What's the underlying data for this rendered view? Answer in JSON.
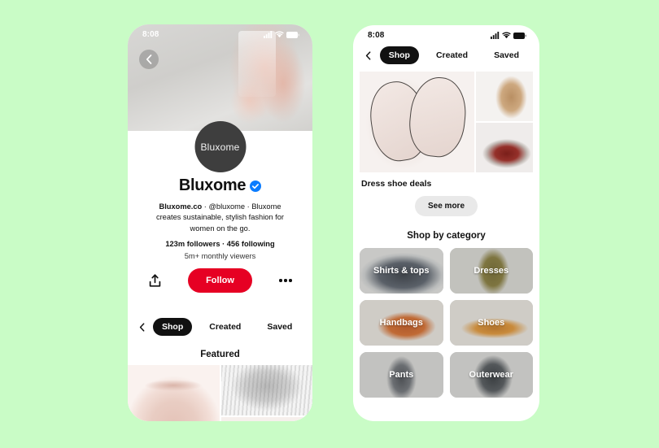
{
  "canvas": {
    "background_color": "#c9fcc6"
  },
  "phones": {
    "left": {
      "status": {
        "time": "8:08",
        "signal_icon": "cellular-signal-icon",
        "wifi_icon": "wifi-icon",
        "battery_icon": "battery-icon"
      },
      "back_icon": "back-chevron-icon",
      "avatar": {
        "label": "Bluxome",
        "icon": "avatar"
      },
      "profile": {
        "name": "Bluxome",
        "verified_icon": "verified-badge-icon",
        "site": "Bluxome.co",
        "handle": "@bluxome",
        "bio": "Bluxome creates sustainable, stylish fashion for women on the go.",
        "separator": " · ",
        "stats": "123m followers · 456 following",
        "viewers": "5m+ monthly viewers"
      },
      "actions": {
        "share_icon": "share-icon",
        "follow_label": "Follow",
        "follow_color": "#e60023",
        "more_icon": "more-options-icon"
      },
      "tabs": {
        "chevron_icon": "back-chevron-icon",
        "items": [
          {
            "label": "Shop",
            "active": true
          },
          {
            "label": "Created",
            "active": false
          },
          {
            "label": "Saved",
            "active": false
          }
        ]
      },
      "featured": {
        "title": "Featured",
        "pins": [
          {
            "name": "blush-sweater-pin"
          },
          {
            "name": "grey-fringed-scarf-pin"
          },
          {
            "name": "blush-accessory-pin"
          }
        ]
      }
    },
    "right": {
      "status": {
        "time": "8:08",
        "signal_icon": "cellular-signal-icon",
        "wifi_icon": "wifi-icon",
        "battery_icon": "battery-icon"
      },
      "tabs": {
        "chevron_icon": "back-chevron-icon",
        "items": [
          {
            "label": "Shop",
            "active": true
          },
          {
            "label": "Created",
            "active": false
          },
          {
            "label": "Saved",
            "active": false
          }
        ]
      },
      "deal": {
        "title": "Dress shoe deals",
        "see_more_label": "See more",
        "images": [
          {
            "name": "blush-oxford-shoes-image"
          },
          {
            "name": "tan-pointed-flats-image"
          },
          {
            "name": "burgundy-brogue-image"
          }
        ]
      },
      "categories": {
        "title": "Shop by category",
        "items": [
          {
            "label": "Shirts & tops",
            "art": "art-shirts"
          },
          {
            "label": "Dresses",
            "art": "art-dresses"
          },
          {
            "label": "Handbags",
            "art": "art-handbags"
          },
          {
            "label": "Shoes",
            "art": "art-shoes"
          },
          {
            "label": "Pants",
            "art": "art-pants"
          },
          {
            "label": "Outerwear",
            "art": "art-outer"
          }
        ]
      }
    }
  }
}
